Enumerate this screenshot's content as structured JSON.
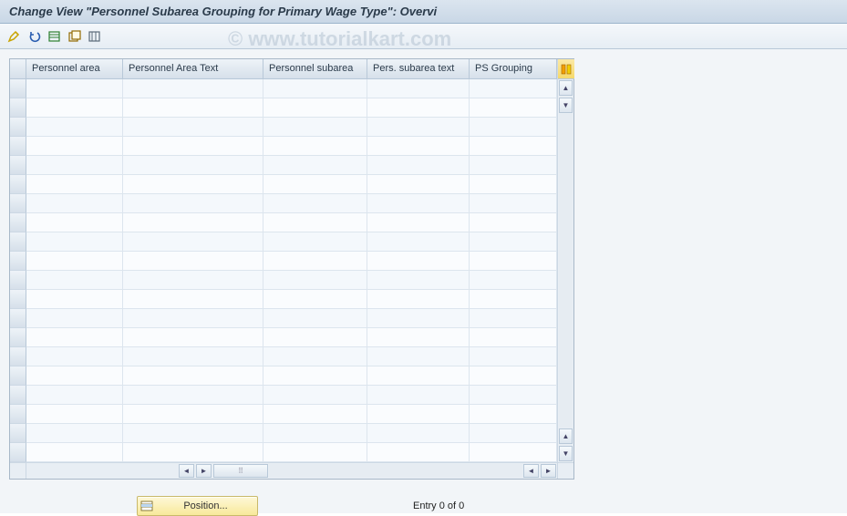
{
  "title": "Change View \"Personnel Subarea Grouping for Primary Wage Type\": Overvi",
  "watermark": "© www.tutorialkart.com",
  "toolbar": {
    "icons": [
      "edit-pencil",
      "undo-arrow",
      "new-entries",
      "copy-entries",
      "delimit"
    ]
  },
  "table": {
    "columns": [
      "Personnel area",
      "Personnel Area Text",
      "Personnel subarea",
      "Pers. subarea text",
      "PS Grouping"
    ],
    "rows": 20
  },
  "footer": {
    "position_label": "Position...",
    "entry_status": "Entry 0 of 0"
  }
}
